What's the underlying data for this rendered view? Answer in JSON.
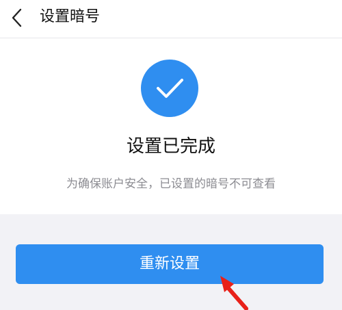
{
  "header": {
    "back_icon": "chevron-left-icon",
    "title": "设置暗号"
  },
  "status": {
    "icon": "checkmark-circle-icon",
    "heading": "设置已完成",
    "note": "为确保账户安全，已设置的暗号不可查看"
  },
  "actions": {
    "reset_label": "重新设置"
  },
  "annotation": {
    "icon": "red-arrow-icon"
  },
  "colors": {
    "accent": "#2f8ef0",
    "background": "#f2f2f6",
    "card": "#ffffff",
    "title_text": "#111111",
    "secondary_text": "#8c8c92",
    "annotation_arrow": "#e8211a"
  }
}
